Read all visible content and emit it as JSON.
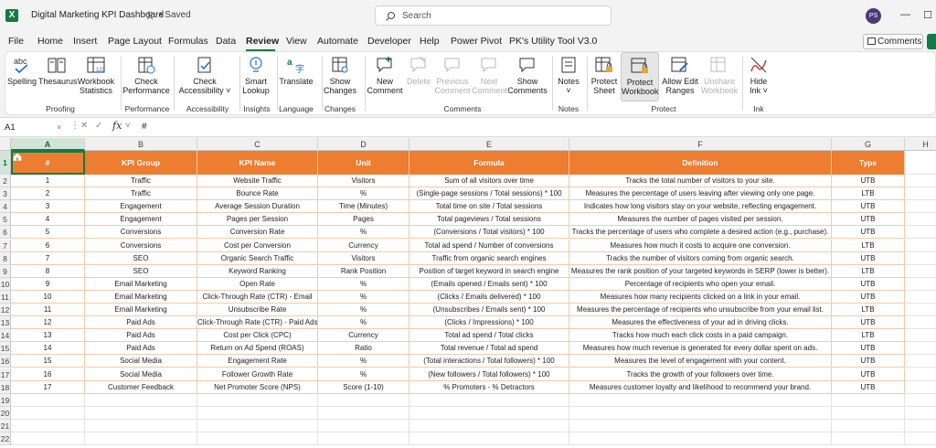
{
  "window": {
    "title": "Digital Marketing KPI Dashboard",
    "save_state": "• Saved",
    "search_placeholder": "Search",
    "user_initials": "PS"
  },
  "menu": [
    "File",
    "Home",
    "Insert",
    "Page Layout",
    "Formulas",
    "Data",
    "Review",
    "View",
    "Automate",
    "Developer",
    "Help",
    "Power Pivot",
    "PK's Utility Tool V3.0"
  ],
  "menu_active": "Review",
  "comments_label": "Comments",
  "ribbon": {
    "buttons": {
      "spelling": "Spelling",
      "thesaurus": "Thesaurus",
      "workbook_stats_1": "Workbook",
      "workbook_stats_2": "Statistics",
      "check_perf_1": "Check",
      "check_perf_2": "Performance",
      "check_acc_1": "Check",
      "check_acc_2": "Accessibility ˅",
      "smart_lookup_1": "Smart",
      "smart_lookup_2": "Lookup",
      "translate": "Translate",
      "show_changes_1": "Show",
      "show_changes_2": "Changes",
      "new_comment_1": "New",
      "new_comment_2": "Comment",
      "delete": "Delete",
      "prev_comment_1": "Previous",
      "prev_comment_2": "Comment",
      "next_comment_1": "Next",
      "next_comment_2": "Comment",
      "show_comments_1": "Show",
      "show_comments_2": "Comments",
      "notes_1": "Notes",
      "notes_2": "˅",
      "protect_sheet_1": "Protect",
      "protect_sheet_2": "Sheet",
      "protect_wb_1": "Protect",
      "protect_wb_2": "Workbook",
      "allow_edit_1": "Allow Edit",
      "allow_edit_2": "Ranges",
      "unshare_1": "Unshare",
      "unshare_2": "Workbook",
      "hide_ink_1": "Hide",
      "hide_ink_2": "Ink ˅"
    },
    "groups": {
      "proofing": "Proofing",
      "performance": "Performance",
      "accessibility": "Accessibility",
      "insights": "Insights",
      "language": "Language",
      "changes": "Changes",
      "comments": "Comments",
      "notes": "Notes",
      "protect": "Protect",
      "ink": "Ink"
    }
  },
  "formula_bar": {
    "name_box": "A1",
    "fx": "fx",
    "value": "#"
  },
  "columns": [
    "A",
    "B",
    "C",
    "D",
    "E",
    "F",
    "G",
    "H"
  ],
  "header_row": [
    "#",
    "KPI Group",
    "KPI Name",
    "Unit",
    "Formula",
    "Definition",
    "Type"
  ],
  "rows": [
    [
      "1",
      "Traffic",
      "Website Traffic",
      "Visitors",
      "Sum of all visitors over time",
      "Tracks the total number of visitors to your site.",
      "UTB"
    ],
    [
      "2",
      "Traffic",
      "Bounce Rate",
      "%",
      "(Single-page sessions / Total sessions) * 100",
      "Measures the percentage of users leaving after viewing only one page.",
      "LTB"
    ],
    [
      "3",
      "Engagement",
      "Average Session Duration",
      "Time (Minutes)",
      "Total time on site / Total sessions",
      "Indicates how long visitors stay on your website, reflecting engagement.",
      "UTB"
    ],
    [
      "4",
      "Engagement",
      "Pages per Session",
      "Pages",
      "Total pageviews / Total sessions",
      "Measures the number of pages visited per session.",
      "UTB"
    ],
    [
      "5",
      "Conversions",
      "Conversion Rate",
      "%",
      "(Conversions / Total visitors) * 100",
      "Tracks the percentage of users who complete a desired action (e.g., purchase).",
      "UTB"
    ],
    [
      "6",
      "Conversions",
      "Cost per Conversion",
      "Currency",
      "Total ad spend / Number of conversions",
      "Measures how much it costs to acquire one conversion.",
      "LTB"
    ],
    [
      "7",
      "SEO",
      "Organic Search Traffic",
      "Visitors",
      "Traffic from organic search engines",
      "Tracks the number of visitors coming from organic search.",
      "UTB"
    ],
    [
      "8",
      "SEO",
      "Keyword Ranking",
      "Rank Position",
      "Position of target keyword in search engine",
      "Measures the rank position of your targeted keywords in SERP (lower is better).",
      "LTB"
    ],
    [
      "9",
      "Email Marketing",
      "Open Rate",
      "%",
      "(Emails opened / Emails sent) * 100",
      "Percentage of recipients who open your email.",
      "UTB"
    ],
    [
      "10",
      "Email Marketing",
      "Click-Through Rate (CTR) - Email",
      "%",
      "(Clicks / Emails delivered) * 100",
      "Measures how many recipients clicked on a link in your email.",
      "UTB"
    ],
    [
      "11",
      "Email Marketing",
      "Unsubscribe Rate",
      "%",
      "(Unsubscribes / Emails sent) * 100",
      "Measures the percentage of recipients who unsubscribe from your email list.",
      "LTB"
    ],
    [
      "12",
      "Paid Ads",
      "Click-Through Rate (CTR) - Paid Ads",
      "%",
      "(Clicks / Impressions) * 100",
      "Measures the effectiveness of your ad in driving clicks.",
      "UTB"
    ],
    [
      "13",
      "Paid Ads",
      "Cost per Click (CPC)",
      "Currency",
      "Total ad spend / Total clicks",
      "Tracks how much each click costs in a paid campaign.",
      "LTB"
    ],
    [
      "14",
      "Paid Ads",
      "Return on Ad Spend (ROAS)",
      "Ratio",
      "Total revenue / Total ad spend",
      "Measures how much revenue is generated for every dollar spent on ads.",
      "UTB"
    ],
    [
      "15",
      "Social Media",
      "Engagement Rate",
      "%",
      "(Total interactions / Total followers) * 100",
      "Measures the level of engagement with your content.",
      "UTB"
    ],
    [
      "16",
      "Social Media",
      "Follower Growth Rate",
      "%",
      "(New followers / Total followers) * 100",
      "Tracks the growth of your followers over time.",
      "UTB"
    ],
    [
      "17",
      "Customer Feedback",
      "Net Promoter Score (NPS)",
      "Score (1-10)",
      "% Promoters - % Detractors",
      "Measures customer loyalty and likelihood to recommend your brand.",
      "UTB"
    ]
  ],
  "row_numbers": [
    "1",
    "2",
    "3",
    "4",
    "5",
    "6",
    "7",
    "8",
    "9",
    "10",
    "11",
    "12",
    "13",
    "14",
    "15",
    "16",
    "17",
    "18",
    "19",
    "20",
    "21",
    "22"
  ],
  "colors": {
    "header_fill": "#ed7d31",
    "accent": "#107c41"
  }
}
